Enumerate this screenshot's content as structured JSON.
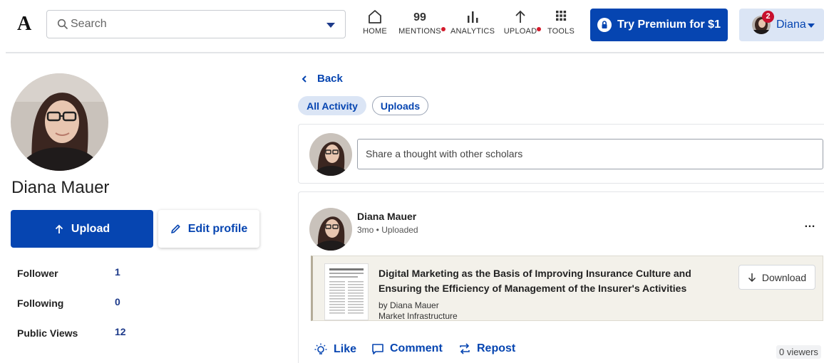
{
  "header": {
    "logo": "A",
    "search": {
      "placeholder": "Search"
    },
    "nav": [
      {
        "label": "HOME",
        "icon": "home-icon",
        "has_notification": false
      },
      {
        "label": "MENTIONS",
        "icon": "quote-icon",
        "has_notification": true
      },
      {
        "label": "ANALYTICS",
        "icon": "analytics-icon",
        "has_notification": false
      },
      {
        "label": "UPLOAD",
        "icon": "upload-icon",
        "has_notification": true
      },
      {
        "label": "TOOLS",
        "icon": "grid-icon",
        "has_notification": false
      }
    ],
    "premium_label": "Try Premium for $1",
    "user": {
      "name": "Diana",
      "notification_count": "2"
    }
  },
  "profile": {
    "name": "Diana Mauer",
    "upload_label": "Upload",
    "edit_label": "Edit profile",
    "stats": [
      {
        "label": "Follower",
        "value": "1"
      },
      {
        "label": "Following",
        "value": "0"
      },
      {
        "label": "Public Views",
        "value": "12"
      }
    ]
  },
  "feed": {
    "back_label": "Back",
    "tabs": [
      {
        "label": "All Activity",
        "active": true
      },
      {
        "label": "Uploads",
        "active": false
      }
    ],
    "composer_placeholder": "Share a thought with other scholars",
    "post": {
      "author": "Diana Mauer",
      "meta": "3mo • Uploaded",
      "more": "…",
      "document": {
        "title": "Digital Marketing as the Basis of Improving Insurance Culture and Ensuring the Efficiency of Management of the Insurer's Activities",
        "by": "by Diana Mauer",
        "venue": "Market Infrastructure",
        "download_label": "Download"
      },
      "actions": {
        "like": "Like",
        "comment": "Comment",
        "repost": "Repost"
      },
      "viewers": "0 viewers"
    }
  },
  "colors": {
    "brand_blue": "#0645b1",
    "light_blue": "#dbe5f5",
    "notification_red": "#d41b2c"
  }
}
